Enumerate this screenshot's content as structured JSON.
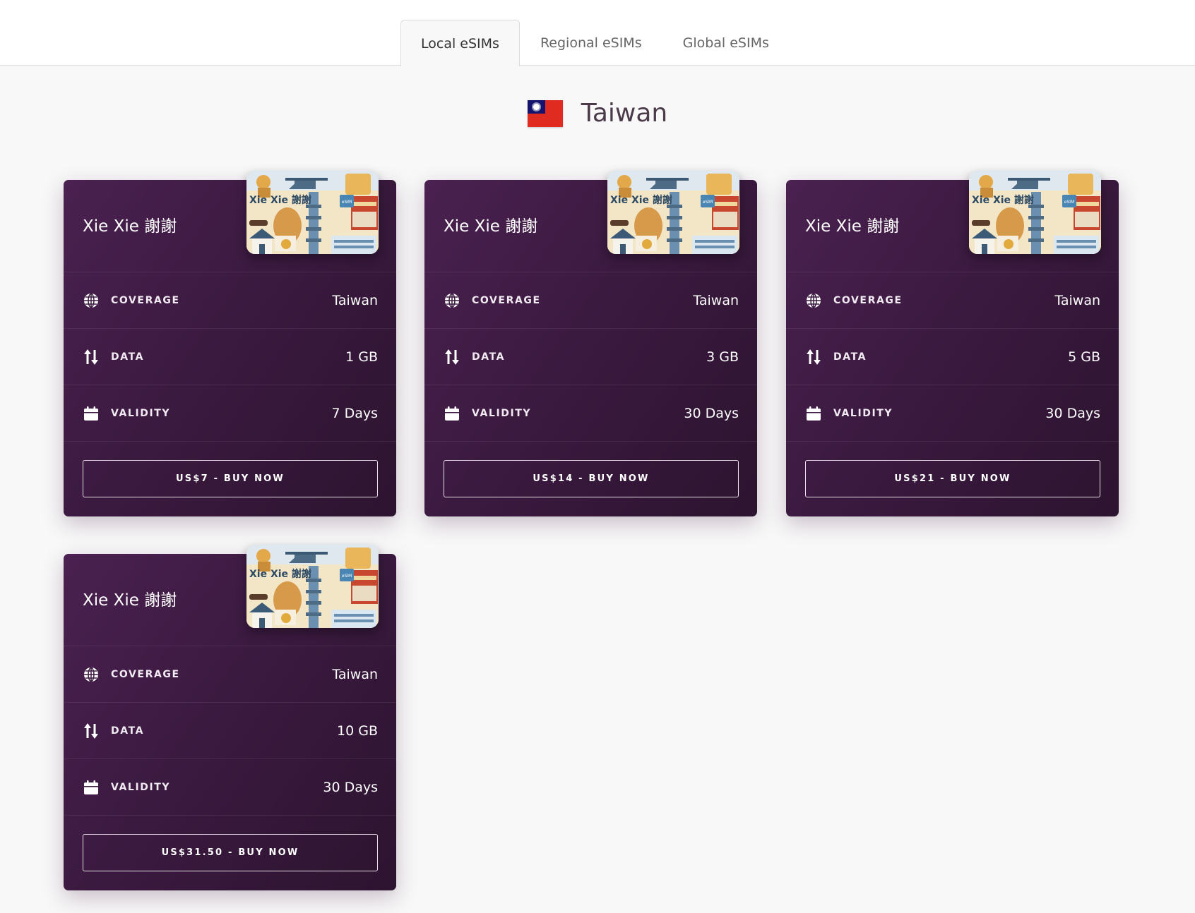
{
  "tabs": [
    {
      "label": "Local eSIMs",
      "active": true
    },
    {
      "label": "Regional eSIMs",
      "active": false
    },
    {
      "label": "Global eSIMs",
      "active": false
    }
  ],
  "country": {
    "name": "Taiwan",
    "flag_icon": "taiwan-flag-icon"
  },
  "labels": {
    "coverage": "COVERAGE",
    "data": "DATA",
    "validity": "VALIDITY"
  },
  "sim_art": {
    "text": "Xie Xie 謝謝",
    "badge": "eSIM"
  },
  "plans": [
    {
      "title": "Xie Xie 謝謝",
      "coverage": "Taiwan",
      "data": "1 GB",
      "validity": "7 Days",
      "button": "US$7 - BUY NOW"
    },
    {
      "title": "Xie Xie 謝謝",
      "coverage": "Taiwan",
      "data": "3 GB",
      "validity": "30 Days",
      "button": "US$14 - BUY NOW"
    },
    {
      "title": "Xie Xie 謝謝",
      "coverage": "Taiwan",
      "data": "5 GB",
      "validity": "30 Days",
      "button": "US$21 - BUY NOW"
    },
    {
      "title": "Xie Xie 謝謝",
      "coverage": "Taiwan",
      "data": "10 GB",
      "validity": "30 Days",
      "button": "US$31.50 - BUY NOW"
    }
  ],
  "colors": {
    "card_gradient_start": "#4a2150",
    "card_gradient_end": "#2d1430",
    "page_bg": "#f8f8f8"
  }
}
